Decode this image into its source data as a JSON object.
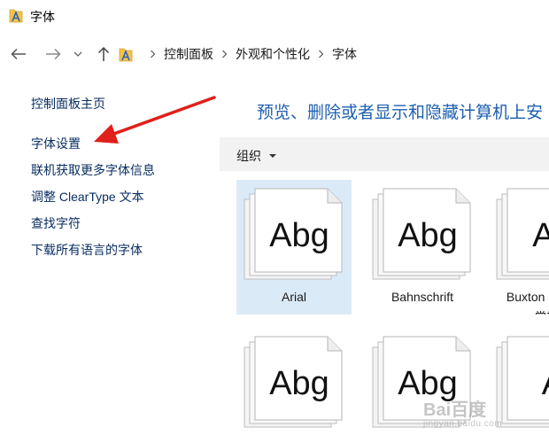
{
  "window": {
    "title": "字体"
  },
  "breadcrumb": [
    "控制面板",
    "外观和个性化",
    "字体"
  ],
  "leftnav": {
    "items": [
      "控制面板主页",
      "字体设置",
      "联机获取更多字体信息",
      "调整 ClearType 文本",
      "查找字符",
      "下载所有语言的字体"
    ]
  },
  "heading": "预览、删除或者显示和隐藏计算机上安",
  "toolbar": {
    "organize_label": "组织"
  },
  "fonts": [
    {
      "sample": "Abg",
      "name": "Arial",
      "subname": "",
      "selected": true
    },
    {
      "sample": "Abg",
      "name": "Bahnschrift",
      "subname": "",
      "selected": false
    },
    {
      "sample": "Abg",
      "name": "Buxton Sketch",
      "subname": "常规",
      "selected": false
    },
    {
      "sample": "Abg",
      "name": "",
      "subname": "",
      "selected": false
    },
    {
      "sample": "Abg",
      "name": "",
      "subname": "",
      "selected": false
    },
    {
      "sample": "Ab",
      "name": "",
      "subname": "",
      "selected": false
    }
  ],
  "watermark": {
    "text": "Bai百度",
    "sub": "jingyan.baidu.com"
  },
  "colors": {
    "link": "#0a2e61",
    "heading": "#1e5fb0",
    "toolbar_bg": "#f2f2f2",
    "selected_tile": "#dbeaf7",
    "arrow": "#e0201b"
  },
  "icons": [
    "font-folder-icon",
    "back-arrow-icon",
    "forward-arrow-icon",
    "recent-dropdown-icon",
    "up-arrow-icon",
    "chevron-right-icon"
  ]
}
